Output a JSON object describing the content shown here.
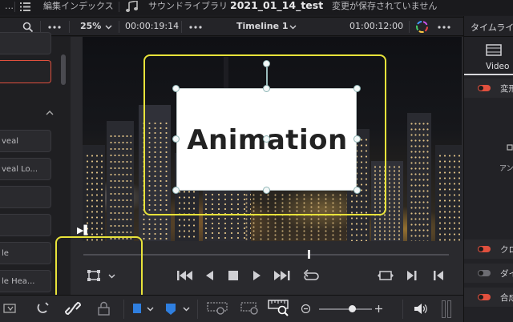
{
  "titlebar": {
    "index_label": "編集インデックス",
    "sound_library_label": "サウンドライブラリ",
    "project_name": "2021_01_14_test",
    "save_status": "変更が保存されていません"
  },
  "viewer_toolbar": {
    "more_icon": "more-dots",
    "zoom": "25%",
    "source_timecode": "00:00:19:14",
    "timeline_name": "Timeline 1",
    "record_timecode": "01:00:12:00"
  },
  "left_panel": {
    "items": [
      "",
      "",
      "veal",
      "veal Lo...",
      "",
      "",
      "le",
      "le Hea..."
    ]
  },
  "viewer": {
    "overlay_text": "Animation",
    "transform_tool": "transform-icon"
  },
  "right_panel": {
    "title": "タイムライン",
    "tab_video": "Video",
    "row1_label": "変形",
    "anchor_label": "アンカ",
    "row_crop": "クロ",
    "row_dynamic": "ダイ",
    "row_composite": "合成",
    "accent_color": "#e0503e"
  }
}
